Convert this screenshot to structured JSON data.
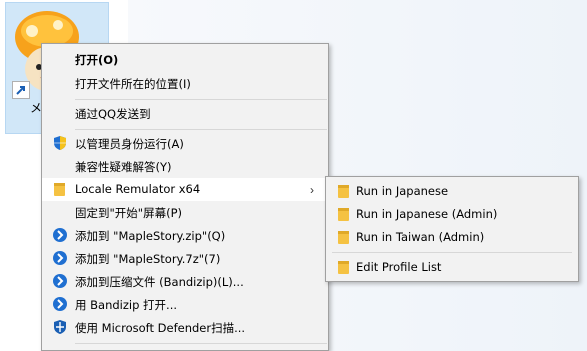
{
  "desktop": {
    "icon_caption": "メイ"
  },
  "context_menu": {
    "items": [
      {
        "label": "打开(O)",
        "bold": true
      },
      {
        "label": "打开文件所在的位置(I)"
      },
      {
        "label": "通过QQ发送到"
      },
      {
        "label": "以管理员身份运行(A)",
        "icon": "uac-shield-icon"
      },
      {
        "label": "兼容性疑难解答(Y)"
      },
      {
        "label": "Locale Remulator x64",
        "icon": "folder-icon",
        "submenu": true
      },
      {
        "label": "固定到\"开始\"屏幕(P)"
      },
      {
        "label": "添加到 \"MapleStory.zip\"(Q)",
        "icon": "bandizip-icon"
      },
      {
        "label": "添加到 \"MapleStory.7z\"(7)",
        "icon": "bandizip-icon"
      },
      {
        "label": "添加到压缩文件 (Bandizip)(L)...",
        "icon": "bandizip-icon"
      },
      {
        "label": "用 Bandizip 打开...",
        "icon": "bandizip-icon"
      },
      {
        "label": "使用 Microsoft Defender扫描...",
        "icon": "defender-shield-icon"
      }
    ]
  },
  "submenu": {
    "items": [
      {
        "label": "Run in Japanese",
        "icon": "folder-icon"
      },
      {
        "label": "Run in Japanese (Admin)",
        "icon": "folder-icon"
      },
      {
        "label": "Run in Taiwan (Admin)",
        "icon": "folder-icon"
      },
      {
        "label": "Edit Profile List",
        "icon": "folder-icon"
      }
    ]
  },
  "colors": {
    "menu_bg": "#f2f2f2",
    "highlight": "#ffffff",
    "folder": "#f5c242",
    "bandizip_blue": "#1f6fd1",
    "shield_blue": "#1a5fb4"
  }
}
